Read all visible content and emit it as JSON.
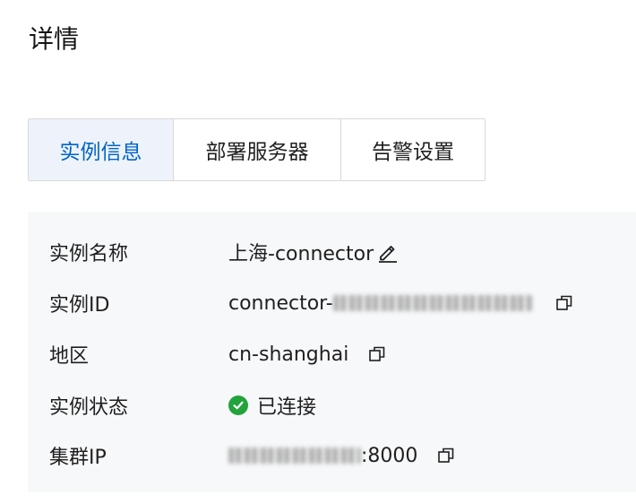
{
  "page": {
    "title": "详情"
  },
  "tabs": [
    {
      "label": "实例信息",
      "active": true
    },
    {
      "label": "部署服务器",
      "active": false
    },
    {
      "label": "告警设置",
      "active": false
    }
  ],
  "info": {
    "name": {
      "label": "实例名称",
      "value": "上海-connector",
      "icon": "edit-icon"
    },
    "id": {
      "label": "实例ID",
      "value_prefix": "connector-",
      "icon": "copy-icon"
    },
    "region": {
      "label": "地区",
      "value": "cn-shanghai",
      "icon": "copy-icon"
    },
    "status": {
      "label": "实例状态",
      "value": "已连接",
      "icon": "check-circle-icon",
      "color": "#23a33b"
    },
    "cluster_ip": {
      "label": "集群IP",
      "value_suffix": ":8000",
      "icon": "copy-icon"
    }
  },
  "colors": {
    "accent": "#0064c8",
    "active_tab_bg": "#eef3fb",
    "panel_bg": "#f7f8fa",
    "success": "#23a33b"
  }
}
